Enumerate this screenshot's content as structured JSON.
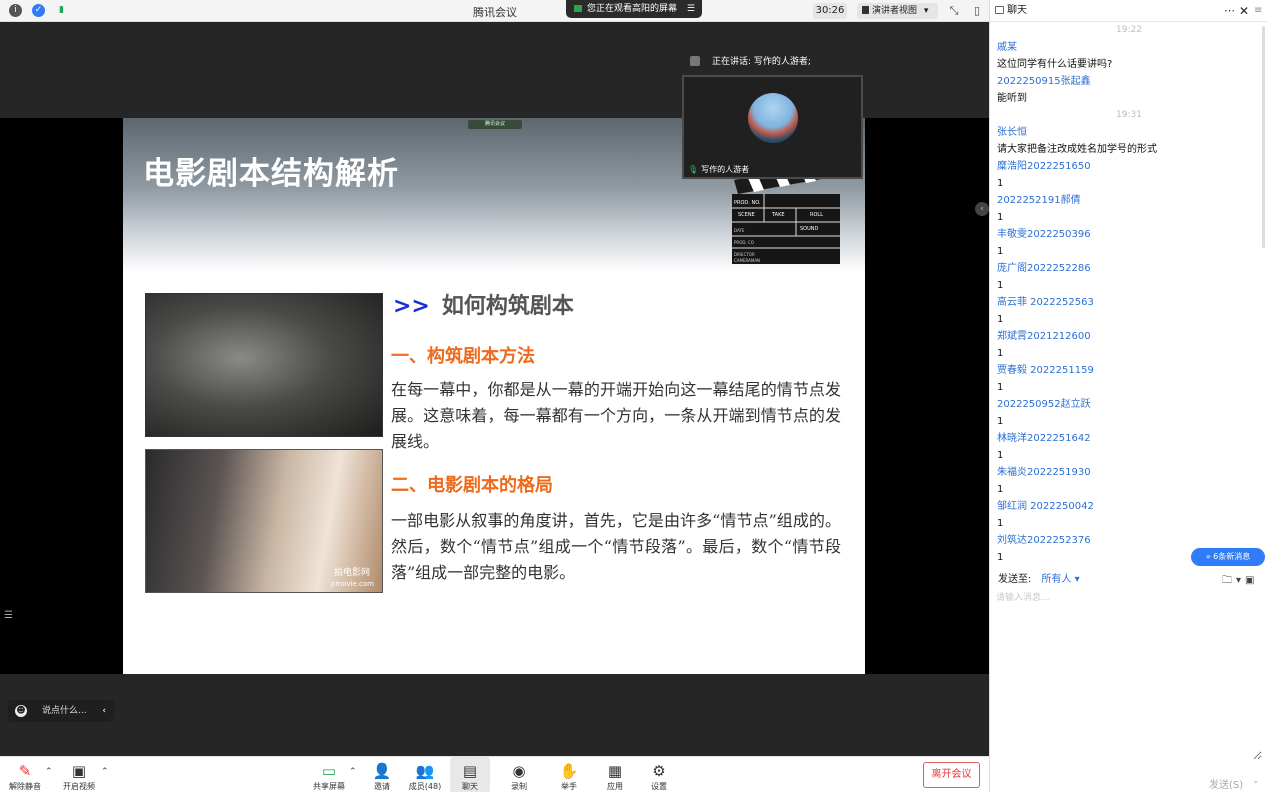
{
  "titlebar": {
    "title": "腾讯会议",
    "share_banner": "您正在观看高阳的屏幕",
    "timer": "30:26",
    "view_mode": "演讲者视图"
  },
  "slide": {
    "title": "电影剧本结构解析",
    "watermark_tag": "腾讯会议",
    "heading_arrows": ">>",
    "heading": "如何构筑剧本",
    "section1_title": "一、构筑剧本方法",
    "section1_text": "在每一幕中，你都是从一幕的开端开始向这一幕结尾的情节点发展。这意味着，每一幕都有一个方向，一条从开端到情节点的发展线。",
    "section2_title": "二、电影剧本的格局",
    "section2_text": "一部电影从叙事的角度讲，首先，它是由许多“情节点”组成的。然后，数个“情节点”组成一个“情节段落”。最后，数个“情节段落”组成一部完整的电影。",
    "image2_watermark": "拍电影网",
    "image2_watermark_url": "pmovie.com",
    "clapper_labels": [
      "PROD. NO.",
      "SCENE",
      "TAKE",
      "ROLL",
      "SOUND",
      "DATE",
      "PROD. CO",
      "DIRECTOR",
      "CAMERAMAN"
    ]
  },
  "speaker": {
    "speaking_label": "正在讲话: 写作的人游者;",
    "camera_name": "写作的人游者"
  },
  "say_box": {
    "placeholder": "说点什么..."
  },
  "toolbar": {
    "mute": "解除静音",
    "video": "开启视频",
    "share": "共享屏幕",
    "invite": "邀请",
    "members": "成员(48)",
    "chat": "聊天",
    "record": "录制",
    "raise": "举手",
    "apps": "应用",
    "settings": "设置",
    "leave": "离开会议"
  },
  "chat": {
    "title": "聊天",
    "messages": [
      {
        "type": "time",
        "text": "19:22"
      },
      {
        "type": "sender",
        "text": "戚某"
      },
      {
        "type": "body",
        "text": "这位同学有什么话要讲吗?"
      },
      {
        "type": "sender",
        "text": "2022250915张起鑫"
      },
      {
        "type": "body",
        "text": "能听到"
      },
      {
        "type": "time",
        "text": "19:31"
      },
      {
        "type": "sender",
        "text": "张长恒"
      },
      {
        "type": "body",
        "text": "请大家把备注改成姓名加学号的形式"
      },
      {
        "type": "sender",
        "text": "糜浩阳2022251650"
      },
      {
        "type": "body",
        "text": "1"
      },
      {
        "type": "sender",
        "text": "2022252191郝倩"
      },
      {
        "type": "body",
        "text": "1"
      },
      {
        "type": "sender",
        "text": "丰敬雯2022250396"
      },
      {
        "type": "body",
        "text": "1"
      },
      {
        "type": "sender",
        "text": "庞广阁2022252286"
      },
      {
        "type": "body",
        "text": "1"
      },
      {
        "type": "sender",
        "text": "高云菲 2022252563"
      },
      {
        "type": "body",
        "text": "1"
      },
      {
        "type": "sender",
        "text": "郑斌霄2021212600"
      },
      {
        "type": "body",
        "text": "1"
      },
      {
        "type": "sender",
        "text": "贾春毅 2022251159"
      },
      {
        "type": "body",
        "text": "1"
      },
      {
        "type": "sender",
        "text": "2022250952赵立跃"
      },
      {
        "type": "body",
        "text": "1"
      },
      {
        "type": "sender",
        "text": "林晓洋2022251642"
      },
      {
        "type": "body",
        "text": "1"
      },
      {
        "type": "sender",
        "text": "朱福炎2022251930"
      },
      {
        "type": "body",
        "text": "1"
      },
      {
        "type": "sender",
        "text": "邹红润 2022250042"
      },
      {
        "type": "body",
        "text": "1"
      },
      {
        "type": "sender",
        "text": "刘筑达2022252376"
      },
      {
        "type": "body",
        "text": "1"
      }
    ],
    "new_messages": "6条新消息",
    "send_to_label": "发送至:",
    "send_to_value": "所有人",
    "input_placeholder": "请输入消息...",
    "send_button": "发送(S)"
  },
  "colors": {
    "accent_blue": "#2f7cf6",
    "sender_blue": "#2c6fd1",
    "leave_red": "#e0383e",
    "slide_orange": "#ee6a1c",
    "slide_arrow_blue": "#1a2fd0"
  }
}
